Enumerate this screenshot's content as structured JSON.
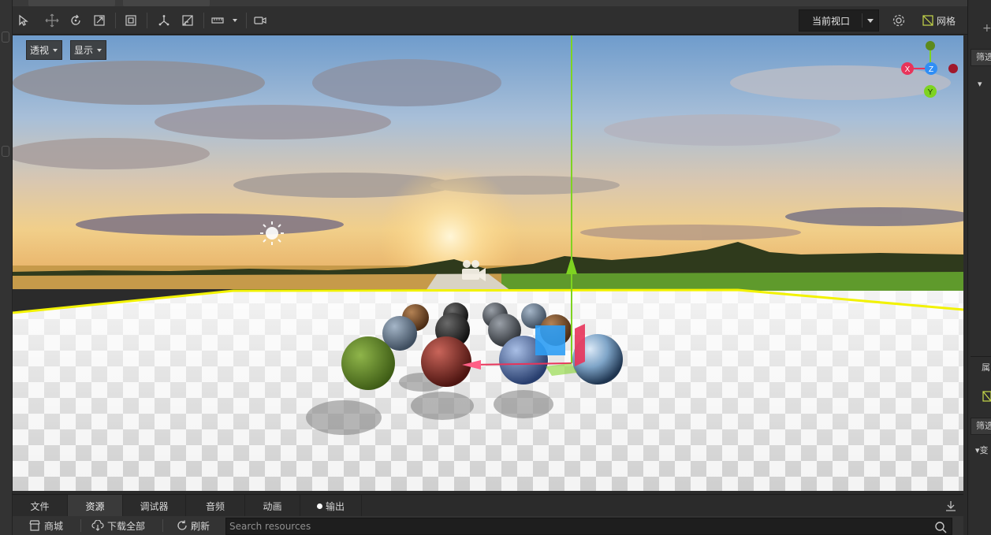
{
  "toolbar": {
    "tools": [
      "select-tool",
      "move-tool",
      "rotate-tool",
      "scale-tool",
      "rect-tool",
      "pivot-tool",
      "snap-tool",
      "layout-tool",
      "camera-tool"
    ],
    "viewport_select": "当前视口",
    "grid_label": "网格"
  },
  "viewport": {
    "projection_label": "透视",
    "display_label": "显示",
    "gizmo_axes": {
      "x": "X",
      "y": "Y",
      "z": "Z"
    },
    "colors": {
      "x_axis": "#e8345a",
      "y_axis": "#7ed321",
      "z_axis": "#2f8ef5",
      "selection": "#f2f200"
    }
  },
  "right_panel": {
    "filter_top": "筛选",
    "props_title": "属",
    "filter_bottom": "筛选",
    "transform_label": "变"
  },
  "bottom_tabs": [
    {
      "label": "文件",
      "active": false
    },
    {
      "label": "资源",
      "active": true
    },
    {
      "label": "调试器",
      "active": false
    },
    {
      "label": "音频",
      "active": false
    },
    {
      "label": "动画",
      "active": false
    },
    {
      "label": "输出",
      "active": false,
      "dot": true
    }
  ],
  "resources_bar": {
    "store_label": "商城",
    "download_all_label": "下载全部",
    "refresh_label": "刷新",
    "search_placeholder": "Search resources"
  }
}
